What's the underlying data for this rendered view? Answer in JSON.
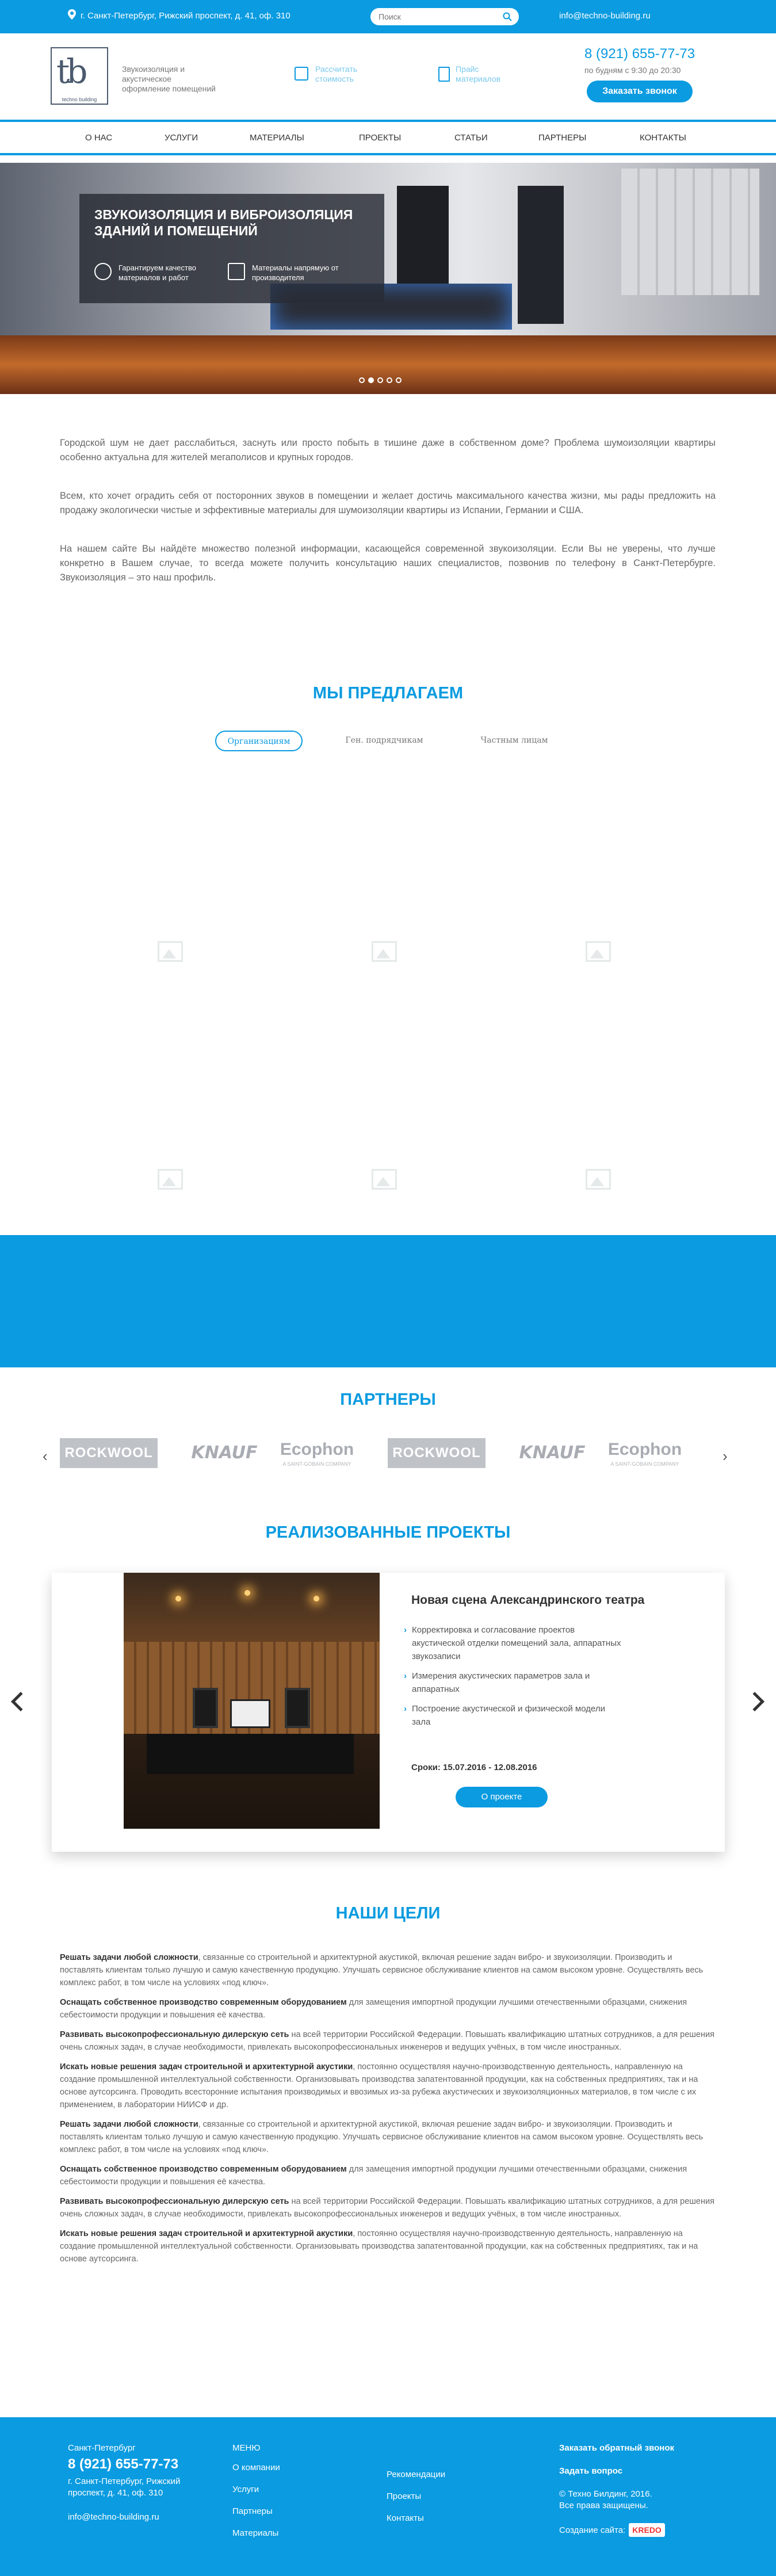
{
  "topbar": {
    "address": "г. Санкт-Петербург, Рижский проспект, д. 41, оф. 310",
    "search_placeholder": "Поиск",
    "email": "info@techno-building.ru"
  },
  "header": {
    "logo_caption": "techno building",
    "tagline": "Звукоизоляция и акустическое оформление помещений",
    "calc_label": "Рассчитать стоимость",
    "price_label": "Прайс материалов",
    "phone": "8 (921) 655-77-73",
    "hours": "по будням с 9:30 до 20:30",
    "call_button": "Заказать звонок"
  },
  "nav": {
    "items": [
      "О нас",
      "Услуги",
      "Материалы",
      "Проекты",
      "Статьи",
      "Партнеры",
      "Контакты"
    ]
  },
  "slider": {
    "title": "Звукоизоляция и виброизоляция зданий и помещений",
    "benefit_1": "Гарантируем качество материалов и работ",
    "benefit_2": "Материалы напрямую от производителя",
    "active_slide": 1,
    "slide_count": 5
  },
  "intro": {
    "p1": "Городской шум не дает расслабиться, заснуть или просто побыть в тишине даже в собственном доме? Проблема шумоизоляции квартиры особенно актуальна для жителей мегаполисов и крупных городов.",
    "p2": "Всем, кто хочет оградить себя от посторонних звуков в помещении и желает достичь максимального качества жизни, мы рады предложить на продажу экологически чистые и эффективные материалы для шумоизоляции квартиры из Испании, Германии и США.",
    "p3": "На нашем сайте Вы найдёте множество полезной информации, касающейся современной звукоизоляции. Если Вы не уверены, что лучше конкретно в Вашем случае, то всегда можете получить консультацию наших специалистов, позвонив по телефону в Санкт-Петербурге. Звукоизоляция – это наш профиль."
  },
  "offer": {
    "title": "Мы предлагаем",
    "tabs": [
      "Организациям",
      "Ген. подрядчикам",
      "Частным лицам"
    ]
  },
  "partners": {
    "title": "Партнеры",
    "logos": [
      "ROCKWOOL",
      "KNAUF",
      "Ecophon",
      "ROCKWOOL",
      "KNAUF",
      "Ecophon"
    ],
    "ecophon_sub": "A SAINT-GOBAIN COMPANY"
  },
  "projects": {
    "title": "Реализованные проекты",
    "name": "Новая сцена Александринского театра",
    "items": [
      "Корректировка и согласование проектов акустической отделки помещений зала, аппаратных звукозаписи",
      "Измерения акустических параметров зала и аппаратных",
      "Построение акустической и физической модели зала"
    ],
    "dates": "Сроки: 15.07.2016 - 12.08.2016",
    "more_button": "О проекте"
  },
  "goals": {
    "title": "Наши цели",
    "paragraphs": [
      {
        "bold": "Решать задачи любой сложности",
        "text": ", связанные со строительной и архитектурной акустикой, включая решение задач вибро- и звукоизоляции. Производить и поставлять клиентам только лучшую и самую качественную продукцию. Улучшать сервисное обслуживание клиентов на самом высоком уровне. Осуществлять весь комплекс работ, в том числе на условиях «под ключ»."
      },
      {
        "bold": "Оснащать собственное производство современным оборудованием",
        "text": " для замещения импортной продукции лучшими отечественными образцами, снижения себестоимости продукции и повышения её качества."
      },
      {
        "bold": "Развивать высокопрофессиональную дилерскую сеть",
        "text": " на всей территории Российской Федерации. Повышать квалификацию штатных сотрудников, а для решения очень сложных задач, в случае необходимости, привлекать высокопрофессиональных инженеров и ведущих учёных, в том числе иностранных."
      },
      {
        "bold": "Искать новые решения задач строительной и архитектурной акустики",
        "text": ", постоянно осуществляя научно-производственную деятельность, направленную на создание промышленной интеллектуальной собственности. Организовывать производства запатентованной продукции, как на собственных предприятиях, так и на основе аутсорсинга. Проводить всесторонние испытания производимых и ввозимых из-за рубежа акустических и звукоизоляционных материалов, в том числе с их применением, в лаборатории НИИСФ и др."
      },
      {
        "bold": "Решать задачи любой сложности",
        "text": ", связанные со строительной и архитектурной акустикой, включая решение задач вибро- и звукоизоляции. Производить и поставлять клиентам только лучшую и самую качественную продукцию. Улучшать сервисное обслуживание клиентов на самом высоком уровне. Осуществлять весь комплекс работ, в том числе на условиях «под ключ»."
      },
      {
        "bold": "Оснащать собственное производство современным оборудованием",
        "text": " для замещения импортной продукции лучшими отечественными образцами, снижения себестоимости продукции и повышения её качества."
      },
      {
        "bold": "Развивать высокопрофессиональную дилерскую сеть",
        "text": " на всей территории Российской Федерации. Повышать квалификацию штатных сотрудников, а для решения очень сложных задач, в случае необходимости, привлекать высокопрофессиональных инженеров и ведущих учёных, в том числе иностранных."
      },
      {
        "bold": "Искать новые решения задач строительной и архитектурной акустики",
        "text": ", постоянно осуществляя научно-производственную деятельность, направленную на создание промышленной интеллектуальной собственности. Организовывать производства запатентованной продукции, как на собственных предприятиях, так и на основе аутсорсинга."
      }
    ]
  },
  "footer": {
    "city": "Санкт-Петербург",
    "phone": "8 (921) 655-77-73",
    "address": "г. Санкт-Петербург, Рижский проспект, д. 41, оф. 310",
    "email": "info@techno-building.ru",
    "menu_title": "МЕНЮ",
    "menu_col1": [
      "О компании",
      "Услуги",
      "Партнеры",
      "Материалы"
    ],
    "menu_col2": [
      "Рекомендации",
      "Проекты",
      "Контакты"
    ],
    "callback": "Заказать обратный звонок",
    "question": "Задать вопрос",
    "copyright": "© Техно Билдинг, 2016.",
    "rights": "Все права защищены.",
    "created_by": "Создание сайта:",
    "kredo": "KREDO"
  },
  "colors": {
    "accent": "#0a9be0"
  }
}
